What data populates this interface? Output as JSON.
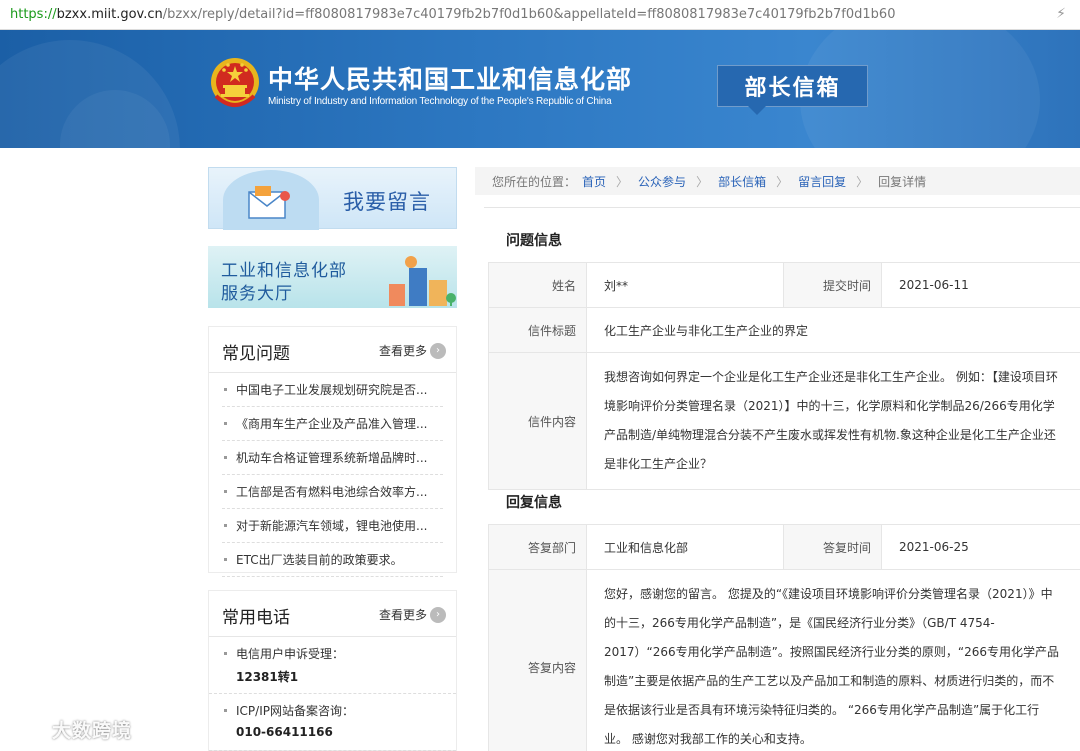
{
  "address_bar": {
    "scheme": "https://",
    "host": "bzxx.miit.gov.cn",
    "path": "/bzxx/reply/detail?id=ff8080817983e7c40179fb2b7f0d1b60&appellateId=ff8080817983e7c40179fb2b7f0d1b60"
  },
  "header": {
    "ministry_cn": "中华人民共和国工业和信息化部",
    "ministry_en": "Ministry of Industry and Information Technology of the People's Republic of China",
    "mailbox": "部长信箱"
  },
  "sidebar": {
    "leave_message": "我要留言",
    "service_hall_line1": "工业和信息化部",
    "service_hall_line2": "服务大厅",
    "faq": {
      "title": "常见问题",
      "more": "查看更多",
      "items": [
        "中国电子工业发展规划研究院是否...",
        "《商用车生产企业及产品准入管理...",
        "机动车合格证管理系统新增品牌时...",
        "工信部是否有燃料电池综合效率方...",
        "对于新能源汽车领域，锂电池使用...",
        "ETC出厂选装目前的政策要求。"
      ]
    },
    "phones": {
      "title": "常用电话",
      "more": "查看更多",
      "items": [
        {
          "label": "电信用户申诉受理：",
          "number": "12381转1"
        },
        {
          "label": "ICP/IP网站备案咨询：",
          "number": "010-66411166"
        }
      ]
    }
  },
  "breadcrumb": {
    "prefix": "您所在的位置：",
    "links": [
      "首页",
      "公众参与",
      "部长信箱",
      "留言回复"
    ],
    "current": "回复详情",
    "separator": "〉"
  },
  "question": {
    "section_title": "问题信息",
    "name_label": "姓名",
    "name": "刘**",
    "submit_time_label": "提交时间",
    "submit_time": "2021-06-11",
    "subject_label": "信件标题",
    "subject": "化工生产企业与非化工生产企业的界定",
    "content_label": "信件内容",
    "content": "我想咨询如何界定一个企业是化工生产企业还是非化工生产企业。 例如：【建设项目环境影响评价分类管理名录（2021）】中的十三，化学原料和化学制品26/266专用化学产品制造/单纯物理混合分装不产生废水或挥发性有机物.象这种企业是化工生产企业还是非化工生产企业？"
  },
  "reply": {
    "section_title": "回复信息",
    "dept_label": "答复部门",
    "dept": "工业和信息化部",
    "reply_time_label": "答复时间",
    "reply_time": "2021-06-25",
    "content_label": "答复内容",
    "content": "您好，感谢您的留言。 您提及的“《建设项目环境影响评价分类管理名录（2021）》中的十三，266专用化学产品制造”，是《国民经济行业分类》（GB/T 4754-2017）“266专用化学产品制造”。按照国民经济行业分类的原则，“266专用化学产品制造”主要是依据产品的生产工艺以及产品加工和制造的原料、材质进行归类的，而不是依据该行业是否具有环境污染特征归类的。 “266专用化学产品制造”属于化工行业。 感谢您对我部工作的关心和支持。"
  },
  "watermark": "大数跨境",
  "colors": {
    "banner_blue": "#2d78c2",
    "link_blue": "#2a63b8",
    "url_green": "#1a9a1a"
  }
}
